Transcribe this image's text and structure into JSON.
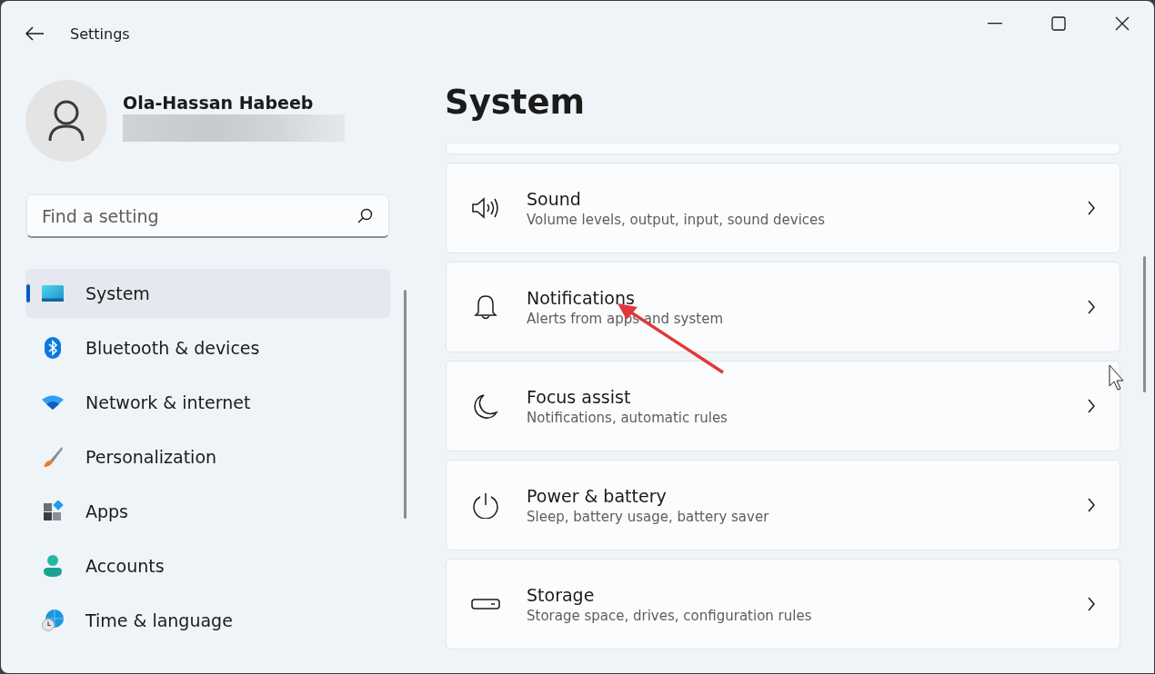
{
  "window": {
    "title": "Settings"
  },
  "user": {
    "name": "Ola-Hassan Habeeb"
  },
  "search": {
    "placeholder": "Find a setting"
  },
  "sidebar": {
    "items": [
      {
        "kind": "system",
        "label": "System",
        "selected": true
      },
      {
        "kind": "bluetooth",
        "label": "Bluetooth & devices",
        "selected": false
      },
      {
        "kind": "network",
        "label": "Network & internet",
        "selected": false
      },
      {
        "kind": "personalization",
        "label": "Personalization",
        "selected": false
      },
      {
        "kind": "apps",
        "label": "Apps",
        "selected": false
      },
      {
        "kind": "accounts",
        "label": "Accounts",
        "selected": false
      },
      {
        "kind": "time",
        "label": "Time & language",
        "selected": false
      }
    ]
  },
  "content": {
    "title": "System",
    "cards": [
      {
        "kind": "sound",
        "title": "Sound",
        "subtitle": "Volume levels, output, input, sound devices"
      },
      {
        "kind": "notifications",
        "title": "Notifications",
        "subtitle": "Alerts from apps and system"
      },
      {
        "kind": "focus",
        "title": "Focus assist",
        "subtitle": "Notifications, automatic rules"
      },
      {
        "kind": "power",
        "title": "Power & battery",
        "subtitle": "Sleep, battery usage, battery saver"
      },
      {
        "kind": "storage",
        "title": "Storage",
        "subtitle": "Storage space, drives, configuration rules"
      }
    ]
  }
}
